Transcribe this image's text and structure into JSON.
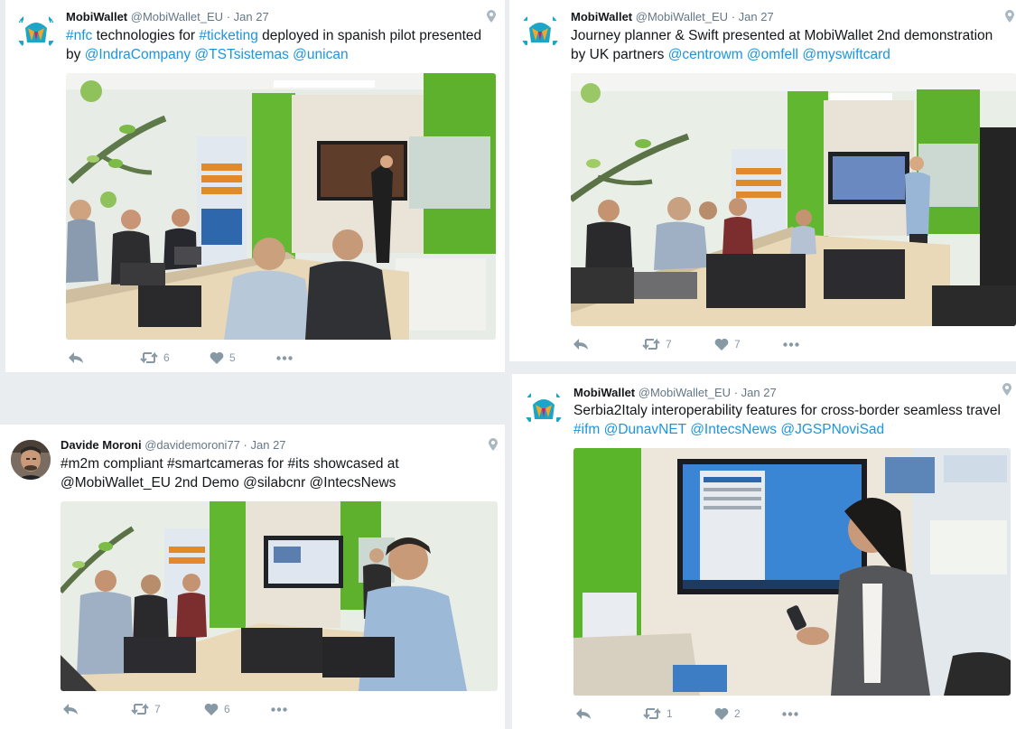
{
  "tweets": [
    {
      "name": "MobiWallet",
      "handle": "@MobiWallet_EU",
      "dot": "·",
      "date": "Jan 27",
      "text": [
        {
          "t": "#nfc",
          "hl": true
        },
        {
          "t": " technologies for ",
          "hl": false
        },
        {
          "t": "#ticketing",
          "hl": true
        },
        {
          "t": " deployed in spanish pilot presented by ",
          "hl": false
        },
        {
          "t": "@IndraCompany",
          "hl": true
        },
        {
          "t": " ",
          "hl": false
        },
        {
          "t": "@TSTsistemas",
          "hl": true
        },
        {
          "t": " ",
          "hl": false
        },
        {
          "t": "@unican",
          "hl": true
        }
      ],
      "retweets": "6",
      "likes": "5"
    },
    {
      "name": "MobiWallet",
      "handle": "@MobiWallet_EU",
      "dot": "·",
      "date": "Jan 27",
      "text": [
        {
          "t": "Journey planner &  Swift presented at MobiWallet 2nd demonstration by UK partners ",
          "hl": false
        },
        {
          "t": "@centrowm",
          "hl": true
        },
        {
          "t": " ",
          "hl": false
        },
        {
          "t": "@omfell",
          "hl": true
        },
        {
          "t": " ",
          "hl": false
        },
        {
          "t": "@myswiftcard",
          "hl": true
        }
      ],
      "retweets": "7",
      "likes": "7"
    },
    {
      "name": "Davide Moroni",
      "handle": "@davidemoroni77",
      "dot": "·",
      "date": "Jan 27",
      "text": [
        {
          "t": "#m2m compliant #smartcameras for #its showcased at @MobiWallet_EU 2nd Demo @silabcnr @IntecsNews",
          "hl": false
        }
      ],
      "retweets": "7",
      "likes": "6"
    },
    {
      "name": "MobiWallet",
      "handle": "@MobiWallet_EU",
      "dot": "·",
      "date": "Jan 27",
      "text": [
        {
          "t": "Serbia2Italy interoperability features for cross-border seamless travel ",
          "hl": false
        },
        {
          "t": "#ifm",
          "hl": true
        },
        {
          "t": " ",
          "hl": false
        },
        {
          "t": "@DunavNET",
          "hl": true
        },
        {
          "t": " ",
          "hl": false
        },
        {
          "t": "@IntecsNews",
          "hl": true
        },
        {
          "t": " ",
          "hl": false
        },
        {
          "t": "@JGSPNoviSad",
          "hl": true
        }
      ],
      "retweets": "1",
      "likes": "2"
    }
  ],
  "icons": {
    "avatar_brand": "mobiwallet-logo-icon",
    "avatar_person": "user-avatar-icon",
    "location": "location-pin-icon",
    "reply": "reply-icon",
    "retweet": "retweet-icon",
    "like": "heart-icon",
    "more": "more-icon"
  },
  "colors": {
    "link": "#1b95e0",
    "meta": "#657786",
    "action": "#8899a6",
    "brand_teal": "#1ba6c9",
    "brand_orange": "#f5a623",
    "brand_magenta": "#d81b60"
  }
}
